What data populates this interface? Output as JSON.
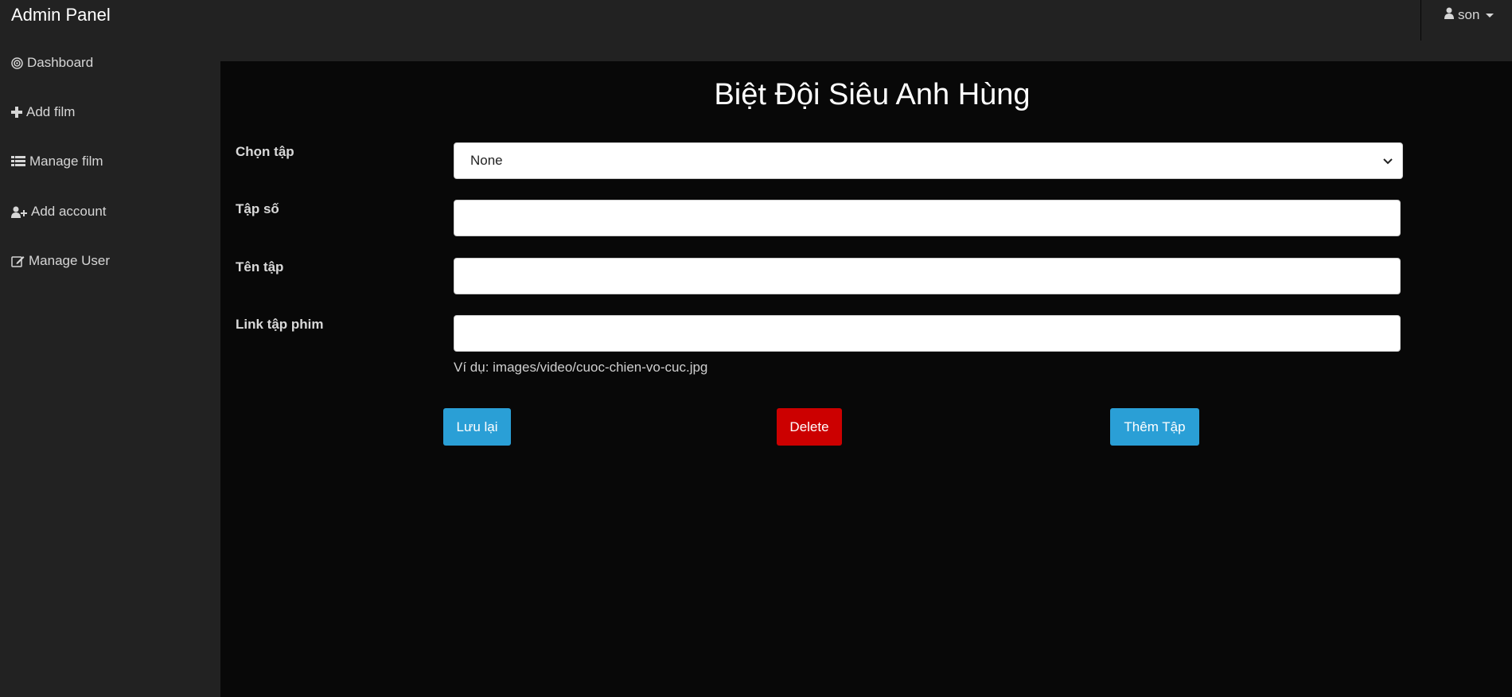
{
  "navbar": {
    "brand": "Admin Panel",
    "user": {
      "name": "son",
      "icon": "user-icon"
    }
  },
  "sidebar": {
    "items": [
      {
        "label": "Dashboard",
        "icon": "target-icon"
      },
      {
        "label": "Add film",
        "icon": "plus-icon"
      },
      {
        "label": "Manage film",
        "icon": "list-icon"
      },
      {
        "label": "Add account",
        "icon": "user-plus-icon"
      },
      {
        "label": "Manage User",
        "icon": "edit-icon"
      }
    ]
  },
  "main": {
    "title": "Biệt Đội Siêu Anh Hùng",
    "form": {
      "episode_select": {
        "label": "Chọn tập",
        "value": "None"
      },
      "episode_number": {
        "label": "Tập số",
        "value": ""
      },
      "episode_name": {
        "label": "Tên tập",
        "value": ""
      },
      "episode_link": {
        "label": "Link tập phim",
        "value": ""
      },
      "hint": "Ví dụ: images/video/cuoc-chien-vo-cuc.jpg"
    },
    "buttons": {
      "save": "Lưu lại",
      "delete": "Delete",
      "add_episode": "Thêm Tập"
    }
  },
  "colors": {
    "primary": "#2a9fd6",
    "danger": "#cc0000",
    "background": "#080808",
    "navbar": "#222222"
  }
}
